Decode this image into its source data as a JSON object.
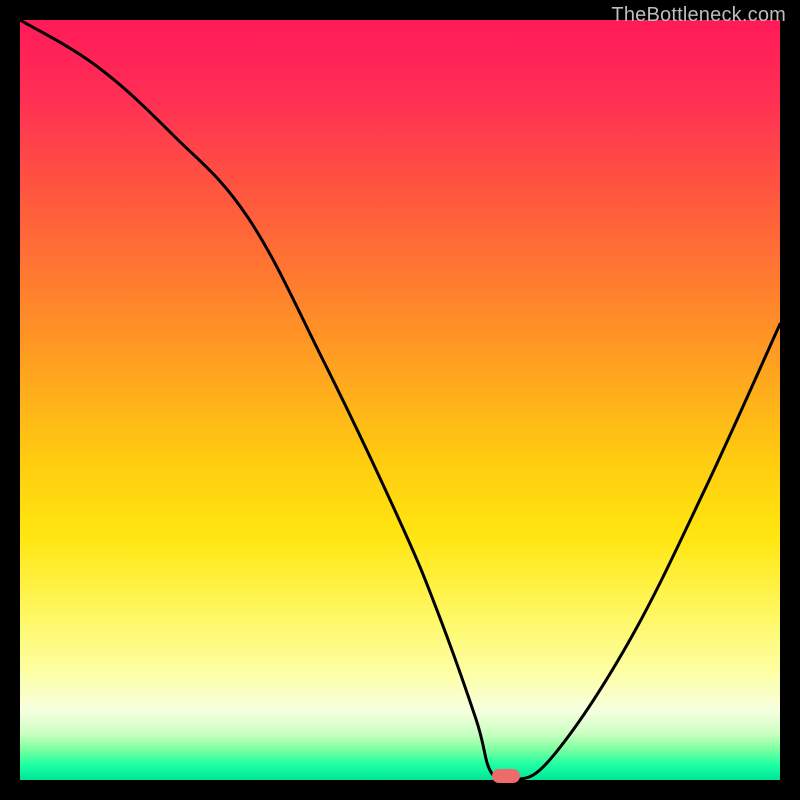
{
  "watermark": "TheBottleneck.com",
  "chart_data": {
    "type": "line",
    "title": "",
    "xlabel": "",
    "ylabel": "",
    "xlim": [
      0,
      100
    ],
    "ylim": [
      0,
      100
    ],
    "x": [
      0,
      10,
      20,
      30,
      40,
      50,
      55,
      60,
      62,
      65,
      70,
      80,
      90,
      100
    ],
    "values": [
      103,
      94,
      85,
      74,
      55,
      34,
      22,
      8,
      1,
      0,
      3,
      18,
      38,
      60
    ],
    "minimum_x": 64,
    "minimum_y": 0,
    "marker": {
      "x": 64,
      "y": 0.5,
      "color": "#ed6b6b"
    },
    "gradient_stops": [
      {
        "p": 0,
        "c": "#ff1a5a"
      },
      {
        "p": 100,
        "c": "#00e599"
      }
    ]
  },
  "plot": {
    "inner_left": 20,
    "inner_top": 20,
    "inner_width": 760,
    "inner_height": 760
  }
}
